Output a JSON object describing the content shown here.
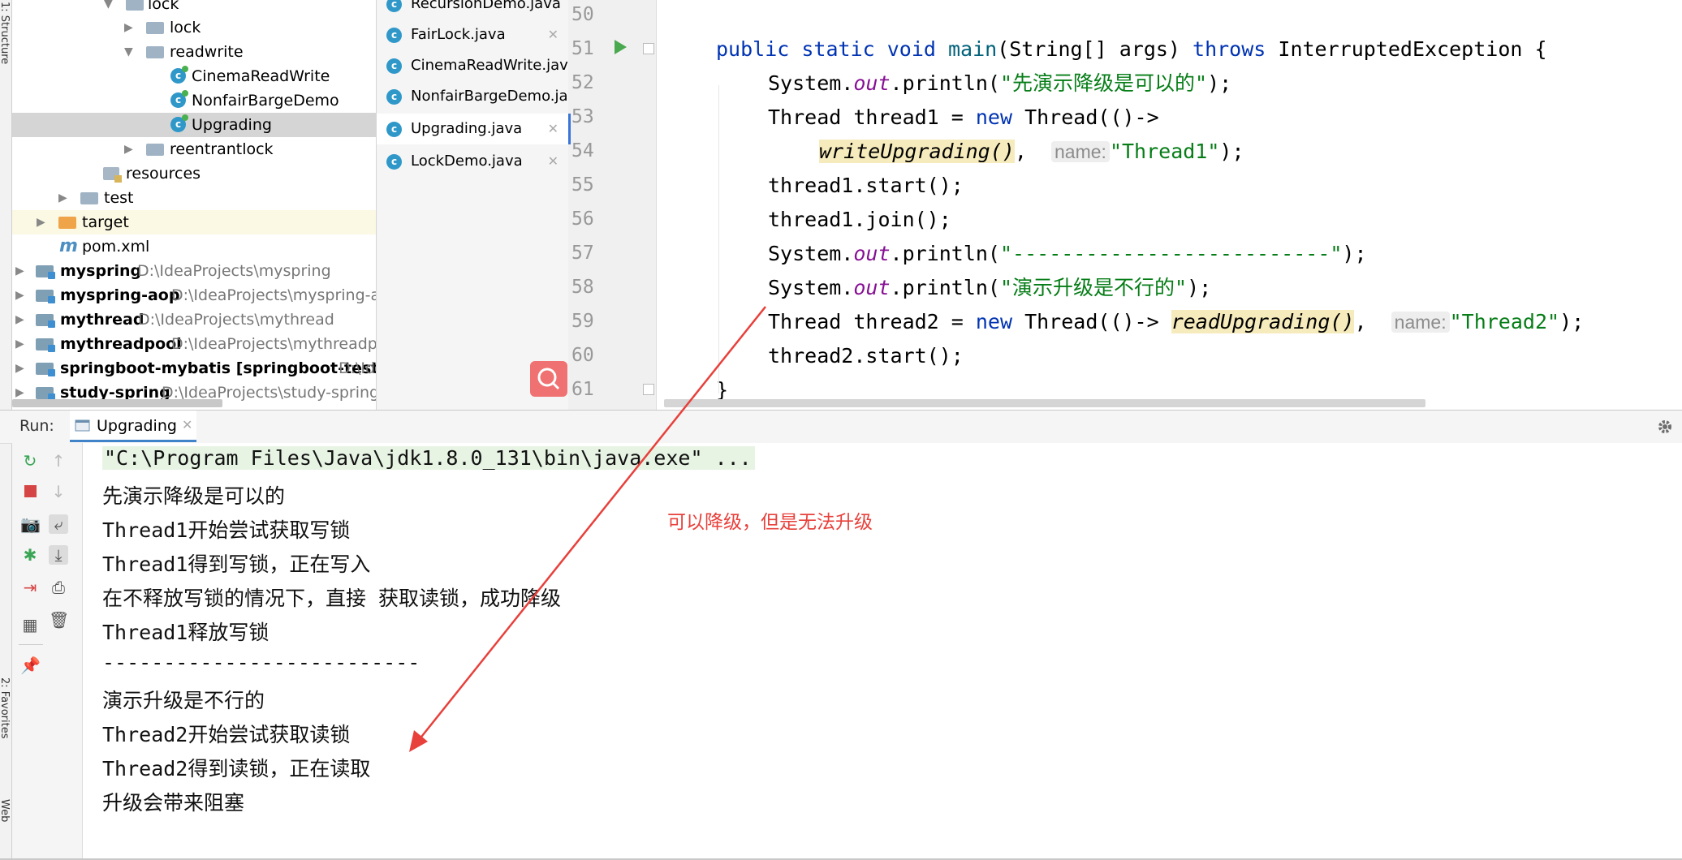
{
  "left_strip": {
    "top_label": "1: Structure",
    "bottom_label": "2: Favorites",
    "bottom2_label": "Web"
  },
  "tree": {
    "items": [
      {
        "label": "lock",
        "type": "package"
      },
      {
        "label": "lock",
        "type": "package"
      },
      {
        "label": "readwrite",
        "type": "package"
      },
      {
        "label": "CinemaReadWrite",
        "type": "class"
      },
      {
        "label": "NonfairBargeDemo",
        "type": "class"
      },
      {
        "label": "Upgrading",
        "type": "class",
        "selected": true
      },
      {
        "label": "reentrantlock",
        "type": "package"
      },
      {
        "label": "resources",
        "type": "resources"
      },
      {
        "label": "test",
        "type": "folder"
      },
      {
        "label": "target",
        "type": "folder-orange"
      },
      {
        "label": "pom.xml",
        "type": "maven"
      },
      {
        "label": "myspring",
        "path": "D:\\IdeaProjects\\myspring",
        "type": "module"
      },
      {
        "label": "myspring-aop",
        "path": "D:\\IdeaProjects\\myspring-aop",
        "type": "module"
      },
      {
        "label": "mythread",
        "path": "D:\\IdeaProjects\\mythread",
        "type": "module"
      },
      {
        "label": "mythreadpool",
        "path": "D:\\IdeaProjects\\mythreadpool",
        "type": "module"
      },
      {
        "label": "springboot-mybatis [springboot-test]",
        "path": "D:\\Ide",
        "type": "module"
      },
      {
        "label": "study-spring",
        "path": "D:\\IdeaProjects\\study-spring",
        "type": "module"
      }
    ]
  },
  "tabs": [
    {
      "label": "RecursionDemo.java"
    },
    {
      "label": "FairLock.java"
    },
    {
      "label": "CinemaReadWrite.java"
    },
    {
      "label": "NonfairBargeDemo.java"
    },
    {
      "label": "Upgrading.java",
      "active": true
    },
    {
      "label": "LockDemo.java"
    }
  ],
  "editor": {
    "line_numbers": [
      "50",
      "51",
      "52",
      "53",
      "54",
      "55",
      "56",
      "57",
      "58",
      "59",
      "60",
      "61"
    ],
    "code": {
      "l51_kw": "public static void ",
      "l51_fn": "main",
      "l51_a": "(String[] args) ",
      "l51_throws": "throws",
      "l51_b": " InterruptedException {",
      "l52_a": "System.",
      "l52_out": "out",
      "l52_b": ".println(",
      "l52_str": "\"先演示降级是可以的\"",
      "l52_c": ");",
      "l53_a": "Thread thread1 = ",
      "l53_new": "new",
      "l53_b": " Thread(()->",
      "l54_call": "writeUpgrading()",
      "l54_sep": ", ",
      "l54_hint": "name:",
      "l54_str": "\"Thread1\"",
      "l54_end": ");",
      "l55": "thread1.start();",
      "l56": "thread1.join();",
      "l57_a": "System.",
      "l57_out": "out",
      "l57_b": ".println(",
      "l57_str": "\"--------------------------\"",
      "l57_c": ");",
      "l58_a": "System.",
      "l58_out": "out",
      "l58_b": ".println(",
      "l58_str": "\"演示升级是不行的\"",
      "l58_c": ");",
      "l59_a": "Thread thread2 = ",
      "l59_new": "new",
      "l59_b": " Thread(()-> ",
      "l59_call": "readUpgrading()",
      "l59_sep": ", ",
      "l59_hint": "name:",
      "l59_str": "\"Thread2\"",
      "l59_end": ");",
      "l60": "thread2.start();",
      "l61": "}"
    }
  },
  "run": {
    "label": "Run:",
    "tab_label": "Upgrading",
    "console_lines": [
      "\"C:\\Program Files\\Java\\jdk1.8.0_131\\bin\\java.exe\" ...",
      "先演示降级是可以的",
      "Thread1开始尝试获取写锁",
      "Thread1得到写锁，正在写入",
      "在不释放写锁的情况下，直接 获取读锁，成功降级",
      "Thread1释放写锁",
      "--------------------------",
      "演示升级是不行的",
      "Thread2开始尝试获取读锁",
      "Thread2得到读锁，正在读取",
      "升级会带来阻塞"
    ]
  },
  "annotation": {
    "text": "可以降级，但是无法升级",
    "color": "#e8403b"
  },
  "colors": {
    "keyword": "#0033b3",
    "string": "#067d17",
    "static_field": "#871094",
    "method": "#00627a",
    "highlight": "#f6ebbc"
  }
}
